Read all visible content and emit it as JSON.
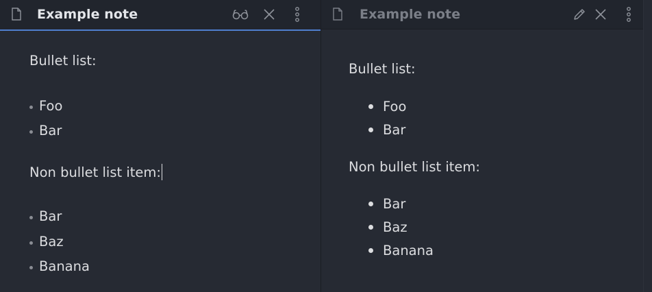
{
  "left_pane": {
    "title": "Example note",
    "actions": [
      "reading-view-glasses-icon",
      "close-icon",
      "more-options-icon"
    ],
    "lines": {
      "heading1": "Bullet list:",
      "list1": [
        "Foo",
        "Bar"
      ],
      "heading2": "Non bullet list item:",
      "list2": [
        "Bar",
        "Baz",
        "Banana"
      ]
    }
  },
  "right_pane": {
    "title": "Example note",
    "actions": [
      "edit-pencil-icon",
      "close-icon",
      "more-options-icon"
    ],
    "lines": {
      "heading1": "Bullet list:",
      "list1": [
        "Foo",
        "Bar"
      ],
      "heading2": "Non bullet list item:",
      "list2": [
        "Bar",
        "Baz",
        "Banana"
      ]
    }
  },
  "colors": {
    "background": "#262a33",
    "header": "#21252d",
    "active_tab_underline": "#4f7fcf",
    "text": "#dcdde0",
    "muted": "#7b7f88"
  }
}
